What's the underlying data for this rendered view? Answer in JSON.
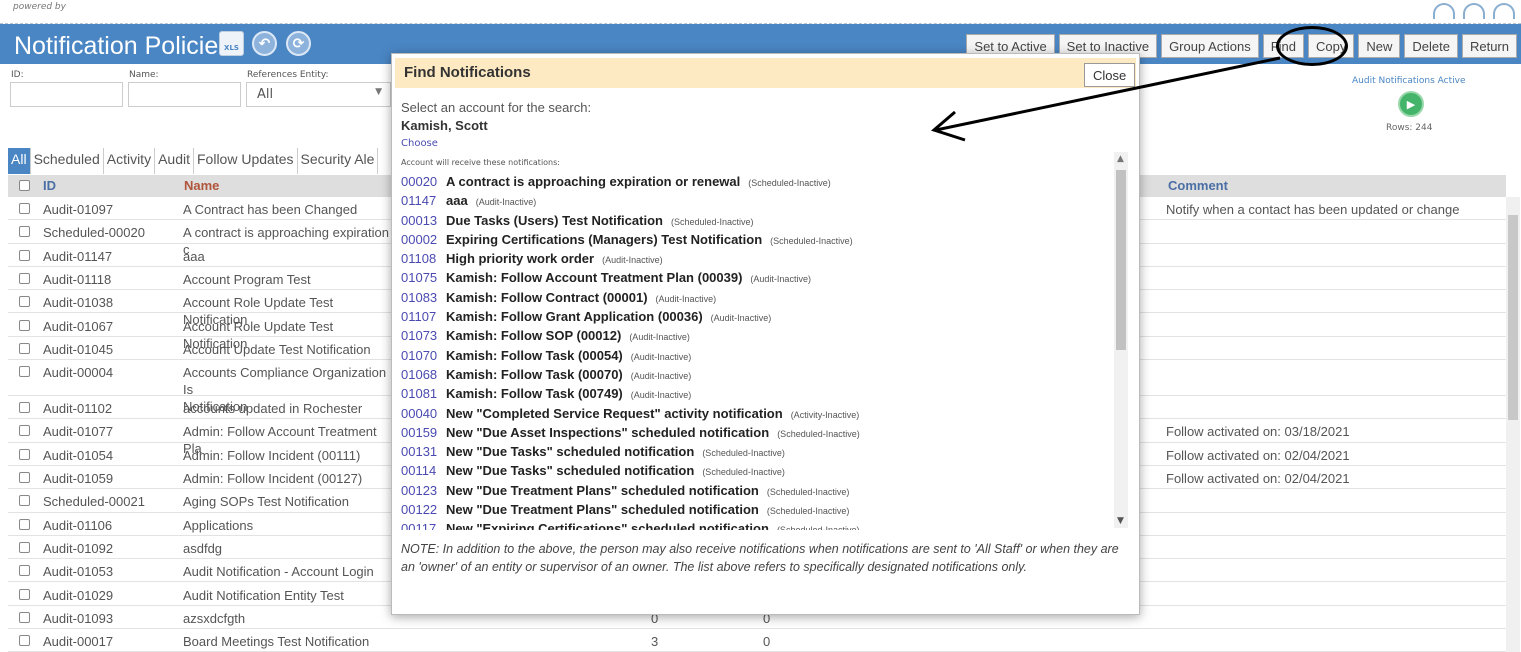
{
  "powered_by": "powered by",
  "header": {
    "title": "Notification Policies",
    "xls_label": "XLS",
    "buttons": [
      "Set to Active",
      "Set to Inactive",
      "Group Actions",
      "Find",
      "Copy",
      "New",
      "Delete",
      "Return"
    ]
  },
  "filters": {
    "id_label": "ID:",
    "name_label": "Name:",
    "entity_label": "References Entity:",
    "entity_value": "All"
  },
  "audit": {
    "label": "Audit Notifications Active",
    "rows": "Rows: 244"
  },
  "tabs": [
    "All",
    "Scheduled",
    "Activity",
    "Audit",
    "Follow Updates",
    "Security Ale"
  ],
  "table": {
    "headers": {
      "id": "ID",
      "name": "Name",
      "comment": "Comment"
    },
    "rows": [
      {
        "id": "Audit-01097",
        "name": "A Contract has been Changed",
        "n1": "",
        "n2": "",
        "comment": "Notify when a contact has been updated or change"
      },
      {
        "id": "Scheduled-00020",
        "name": "A contract is approaching expiration c",
        "n1": "",
        "n2": "",
        "comment": ""
      },
      {
        "id": "Audit-01147",
        "name": "aaa",
        "n1": "",
        "n2": "",
        "comment": ""
      },
      {
        "id": "Audit-01118",
        "name": "Account Program Test",
        "n1": "",
        "n2": "",
        "comment": ""
      },
      {
        "id": "Audit-01038",
        "name": "Account Role Update Test Notification",
        "n1": "",
        "n2": "",
        "comment": ""
      },
      {
        "id": "Audit-01067",
        "name": "Account Role Update Test Notification",
        "n1": "",
        "n2": "",
        "comment": ""
      },
      {
        "id": "Audit-01045",
        "name": "Account Update Test Notification",
        "n1": "",
        "n2": "",
        "comment": ""
      },
      {
        "id": "Audit-00004",
        "name": "Accounts Compliance Organization Is",
        "name2": "Notification",
        "n1": "",
        "n2": "",
        "comment": ""
      },
      {
        "id": "Audit-01102",
        "name": "accounts updated in Rochester",
        "n1": "",
        "n2": "",
        "comment": ""
      },
      {
        "id": "Audit-01077",
        "name": "Admin: Follow Account Treatment Pla",
        "n1": "",
        "n2": "",
        "comment": "Follow activated on: 03/18/2021"
      },
      {
        "id": "Audit-01054",
        "name": "Admin: Follow Incident (00111)",
        "n1": "",
        "n2": "",
        "comment": "Follow activated on: 02/04/2021"
      },
      {
        "id": "Audit-01059",
        "name": "Admin: Follow Incident (00127)",
        "n1": "",
        "n2": "",
        "comment": "Follow activated on: 02/04/2021"
      },
      {
        "id": "Scheduled-00021",
        "name": "Aging SOPs Test Notification",
        "n1": "",
        "n2": "",
        "comment": ""
      },
      {
        "id": "Audit-01106",
        "name": "Applications",
        "n1": "",
        "n2": "",
        "comment": ""
      },
      {
        "id": "Audit-01092",
        "name": "asdfdg",
        "n1": "",
        "n2": "",
        "comment": ""
      },
      {
        "id": "Audit-01053",
        "name": "Audit Notification - Account Login",
        "n1": "",
        "n2": "",
        "comment": ""
      },
      {
        "id": "Audit-01029",
        "name": "Audit Notification Entity Test",
        "n1": "",
        "n2": "",
        "comment": ""
      },
      {
        "id": "Audit-01093",
        "name": "azsxdcfgth",
        "n1": "0",
        "n2": "0",
        "comment": ""
      },
      {
        "id": "Audit-00017",
        "name": "Board Meetings Test Notification",
        "n1": "3",
        "n2": "0",
        "comment": ""
      }
    ]
  },
  "modal": {
    "title": "Find Notifications",
    "close_label": "Close",
    "prompt": "Select an account for the search:",
    "account": "Kamish, Scott",
    "choose": "Choose",
    "receive_label": "Account will receive these notifications:",
    "items": [
      {
        "code": "00020",
        "name": "A contract is approaching expiration or renewal",
        "status": "(Scheduled-Inactive)"
      },
      {
        "code": "01147",
        "name": "aaa",
        "status": "(Audit-Inactive)"
      },
      {
        "code": "00013",
        "name": "Due Tasks (Users) Test Notification",
        "status": "(Scheduled-Inactive)"
      },
      {
        "code": "00002",
        "name": "Expiring Certifications (Managers) Test Notification",
        "status": "(Scheduled-Inactive)"
      },
      {
        "code": "01108",
        "name": "High priority work order",
        "status": "(Audit-Inactive)"
      },
      {
        "code": "01075",
        "name": "Kamish: Follow Account Treatment Plan (00039)",
        "status": "(Audit-Inactive)"
      },
      {
        "code": "01083",
        "name": "Kamish: Follow Contract (00001)",
        "status": "(Audit-Inactive)"
      },
      {
        "code": "01107",
        "name": "Kamish: Follow Grant Application (00036)",
        "status": "(Audit-Inactive)"
      },
      {
        "code": "01073",
        "name": "Kamish: Follow SOP (00012)",
        "status": "(Audit-Inactive)"
      },
      {
        "code": "01070",
        "name": "Kamish: Follow Task (00054)",
        "status": "(Audit-Inactive)"
      },
      {
        "code": "01068",
        "name": "Kamish: Follow Task (00070)",
        "status": "(Audit-Inactive)"
      },
      {
        "code": "01081",
        "name": "Kamish: Follow Task (00749)",
        "status": "(Audit-Inactive)"
      },
      {
        "code": "00040",
        "name": "New \"Completed Service Request\" activity notification",
        "status": "(Activity-Inactive)"
      },
      {
        "code": "00159",
        "name": "New \"Due Asset Inspections\" scheduled notification",
        "status": "(Scheduled-Inactive)"
      },
      {
        "code": "00131",
        "name": "New \"Due Tasks\" scheduled notification",
        "status": "(Scheduled-Inactive)"
      },
      {
        "code": "00114",
        "name": "New \"Due Tasks\" scheduled notification",
        "status": "(Scheduled-Inactive)"
      },
      {
        "code": "00123",
        "name": "New \"Due Treatment Plans\" scheduled notification",
        "status": "(Scheduled-Inactive)"
      },
      {
        "code": "00122",
        "name": "New \"Due Treatment Plans\" scheduled notification",
        "status": "(Scheduled-Inactive)"
      },
      {
        "code": "00117",
        "name": "New \"Expiring Certifications\" scheduled notification",
        "status": "(Scheduled-Inactive)"
      }
    ],
    "note": "NOTE: In addition to the above, the person may also receive notifications when notifications are sent to 'All Staff' or when they are an 'owner' of an entity or supervisor of an owner. The list above refers to specifically designated notifications only."
  },
  "colors": {
    "header_blue": "#4a86c4",
    "modal_header": "#fde9c2",
    "link_purple": "#4a4ab0",
    "speaker_green": "#43b469"
  }
}
